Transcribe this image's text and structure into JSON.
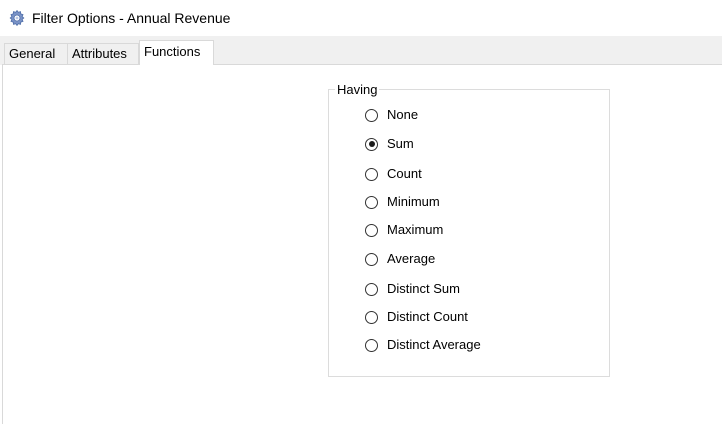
{
  "window": {
    "title": "Filter Options - Annual Revenue",
    "icon": "gear-icon"
  },
  "tabs": [
    {
      "label": "General",
      "selected": false
    },
    {
      "label": "Attributes",
      "selected": false
    },
    {
      "label": "Functions",
      "selected": true
    }
  ],
  "having": {
    "legend": "Having",
    "selected": "Sum",
    "options": [
      {
        "label": "None",
        "checked": false
      },
      {
        "label": "Sum",
        "checked": true
      },
      {
        "label": "Count",
        "checked": false
      },
      {
        "label": "Minimum",
        "checked": false
      },
      {
        "label": "Maximum",
        "checked": false
      },
      {
        "label": "Average",
        "checked": false
      },
      {
        "label": "Distinct Sum",
        "checked": false
      },
      {
        "label": "Distinct Count",
        "checked": false
      },
      {
        "label": "Distinct Average",
        "checked": false
      }
    ]
  },
  "colors": {
    "tabstrip": "#f0f0f0",
    "border": "#d9d9d9",
    "icon_blue": "#5b7fbf"
  }
}
